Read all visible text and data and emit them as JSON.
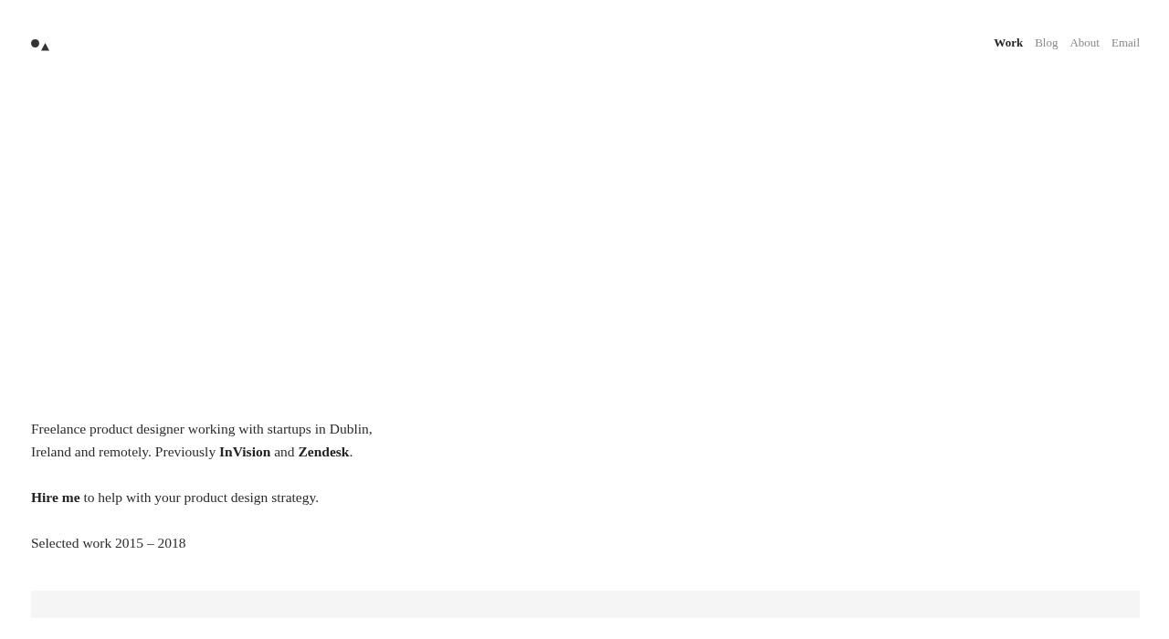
{
  "nav": [
    {
      "label": "Work",
      "selected": true
    },
    {
      "label": "Blog",
      "selected": false
    },
    {
      "label": "About",
      "selected": false
    },
    {
      "label": "Email",
      "selected": false
    }
  ],
  "intro": [
    "Freelance product designer working with startups in Dublin, Ireland and remotely. Previously **InVision** and **Zendesk**.",
    "**Hire me** to help with your product design strategy."
  ],
  "section_title": "Selected work 2015 – 2018"
}
